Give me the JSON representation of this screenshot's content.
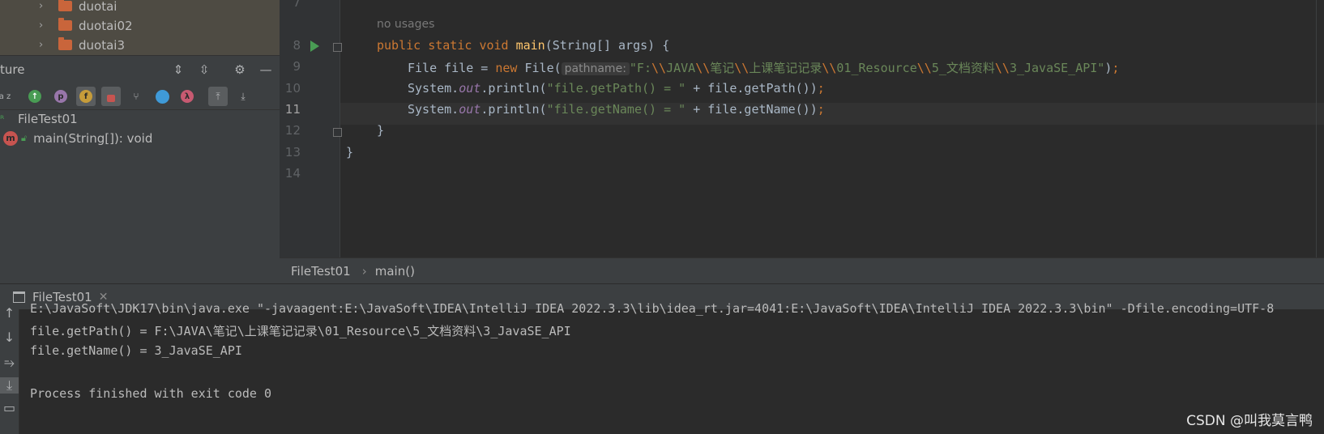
{
  "project_tree": {
    "items": [
      {
        "label": "duotai"
      },
      {
        "label": "duotai02"
      },
      {
        "label": "duotai3"
      }
    ]
  },
  "structure": {
    "title": "ture",
    "toolbar_letters": {
      "p": "p",
      "f": "f",
      "lambda": "λ",
      "sort": "a z"
    },
    "class_name": "FileTest01",
    "method": "main(String[]): void",
    "method_badge": "m"
  },
  "editor": {
    "line_numbers": [
      "7",
      "8",
      "9",
      "10",
      "11",
      "12",
      "13",
      "14"
    ],
    "current_line": "11",
    "inlay_no_usages": "no usages",
    "code": {
      "l8_kw1": "public",
      "l8_kw2": "static",
      "l8_kw3": "void",
      "l8_fn": "main",
      "l8_rest": "(String[] args) {",
      "l9_a": "File file = ",
      "l9_new": "new",
      "l9_b": " File(",
      "l9_hint": "pathname:",
      "l9_s1": "\"F:",
      "l9_s2": "JAVA",
      "l9_s3": "笔记",
      "l9_s4": "上课笔记记录",
      "l9_s5": "01_Resource",
      "l9_s6": "5_文档资料",
      "l9_s7": "3_JavaSE_API\"",
      "esc": "\\\\",
      "l9_end": ")",
      "semi": ";",
      "sys": "System.",
      "out": "out",
      "println": ".println(",
      "l10_str": "\"file.getPath() = \"",
      "l10_rest": " + file.getPath())",
      "l11_str": "\"file.getName() = \"",
      "l11_rest": " + file.getName())",
      "l12": "}",
      "l13": "}"
    }
  },
  "breadcrumb": {
    "file": "FileTest01",
    "sep": "›",
    "method": "main()"
  },
  "run": {
    "tab_label": "FileTest01",
    "console_lines": [
      "E:\\JavaSoft\\JDK17\\bin\\java.exe \"-javaagent:E:\\JavaSoft\\IDEA\\IntelliJ IDEA 2022.3.3\\lib\\idea_rt.jar=4041:E:\\JavaSoft\\IDEA\\IntelliJ IDEA 2022.3.3\\bin\" -Dfile.encoding=UTF-8",
      "file.getPath() = F:\\JAVA\\笔记\\上课笔记记录\\01_Resource\\5_文档资料\\3_JavaSE_API",
      "file.getName() = 3_JavaSE_API",
      "",
      "Process finished with exit code 0"
    ]
  },
  "watermark": "CSDN @叫我莫言鸭",
  "colors": {
    "keyword": "#cc7832",
    "string": "#6a8759",
    "function": "#ffc66d",
    "field": "#9876aa",
    "folder": "#c9653b"
  }
}
